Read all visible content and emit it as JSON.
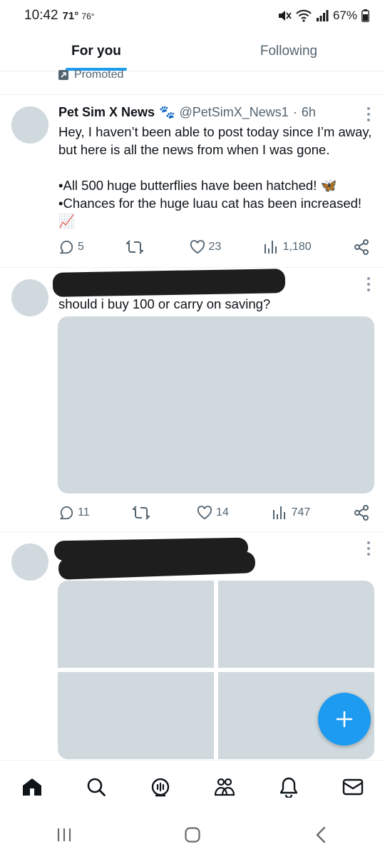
{
  "status_bar": {
    "time": "10:42",
    "temp_high": "71°",
    "temp_low": "76°",
    "battery": "67%"
  },
  "tabs": [
    {
      "label": "For you",
      "active": true
    },
    {
      "label": "Following",
      "active": false
    }
  ],
  "promoted_label": "Promoted",
  "tweets": [
    {
      "author_name": "Pet Sim X News",
      "author_badge": "🐾",
      "handle": "@PetSimX_News1",
      "dot": "·",
      "time": "6h",
      "lines": [
        "Hey, I haven’t been able to post today since I’m away, but here is all the news from when I was gone.",
        "",
        "•All 500 huge butterflies have been hatched! 🦋",
        "•Chances for the huge luau cat has been increased! 📈"
      ],
      "replies": "5",
      "retweets": "",
      "likes": "23",
      "views": "1,180"
    },
    {
      "text": "should i buy 100 or carry on saving?",
      "replies": "11",
      "retweets": "",
      "likes": "14",
      "views": "747"
    }
  ],
  "icons": {
    "reply": "reply-icon",
    "retweet": "retweet-icon",
    "like": "heart-icon",
    "views": "views-icon",
    "share": "share-icon",
    "compose": "plus-icon"
  },
  "bottom_nav": [
    "home-icon",
    "search-icon",
    "spaces-icon",
    "communities-icon",
    "notifications-icon",
    "messages-icon"
  ],
  "colors": {
    "accent": "#1d9bf0",
    "placeholder": "#cfd9de",
    "secondary_text": "#536471"
  }
}
